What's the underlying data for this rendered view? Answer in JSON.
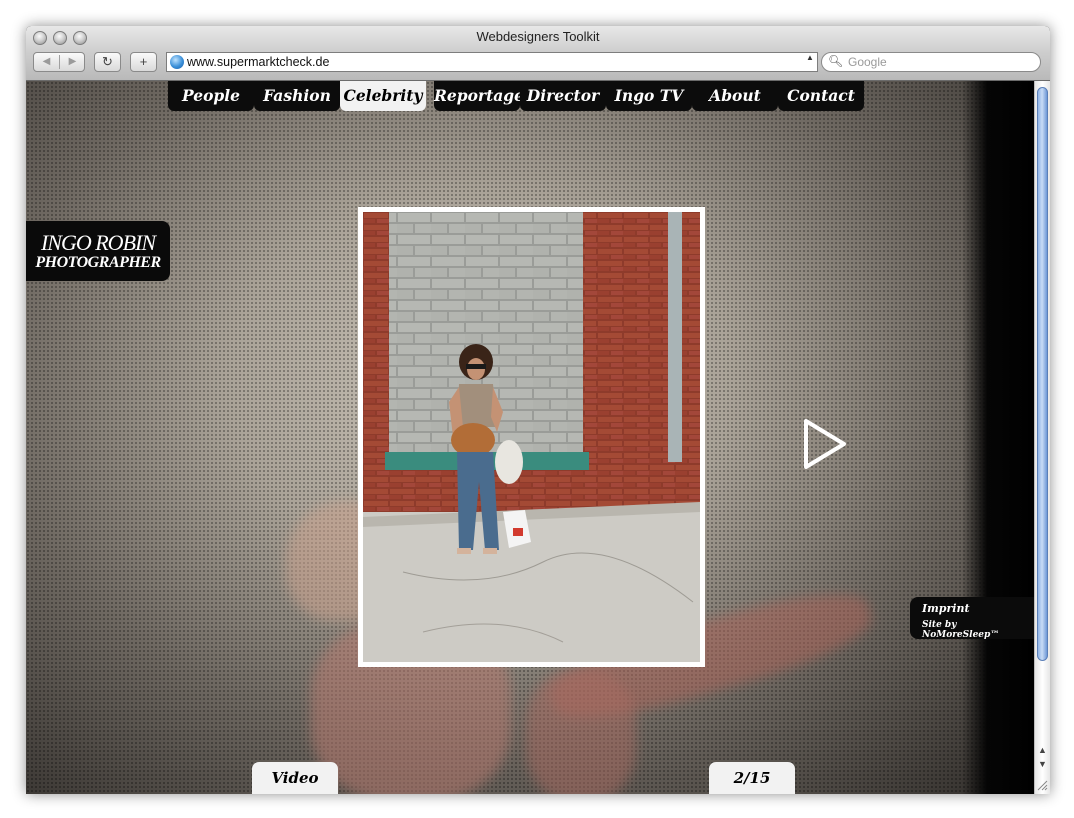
{
  "browser": {
    "title": "Webdesigners Toolkit",
    "url": "www.supermarktcheck.de",
    "search_placeholder": "Google",
    "add_button": "+",
    "reload_icon": "reload-icon",
    "back_icon": "back-arrow-icon",
    "forward_icon": "forward-arrow-icon"
  },
  "nav": {
    "items": [
      {
        "label": "People",
        "active": false
      },
      {
        "label": "Fashion",
        "active": false
      },
      {
        "label": "Celebrity",
        "active": true
      },
      {
        "label": "Reportage",
        "active": false
      },
      {
        "label": "Director",
        "active": false
      },
      {
        "label": "Ingo TV",
        "active": false
      },
      {
        "label": "About",
        "active": false
      },
      {
        "label": "Contact",
        "active": false
      }
    ]
  },
  "brand": {
    "line1": "INGO ROBIN",
    "line2": "PHOTOGRAPHER"
  },
  "gallery": {
    "counter": "2/15",
    "video_label": "Video",
    "next_icon": "play-arrow-icon"
  },
  "footer": {
    "imprint": "Imprint",
    "credit": "Site by NoMoreSleep™"
  },
  "colors": {
    "nav_bg": "#0c0c0c",
    "nav_active_bg": "#f2f2f2",
    "nav_text": "#ffffff"
  }
}
